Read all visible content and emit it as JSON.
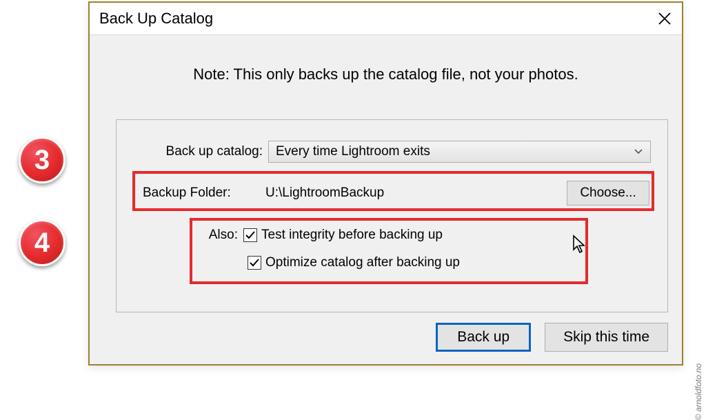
{
  "titlebar": {
    "title": "Back Up Catalog"
  },
  "note": "Note: This only backs up the catalog file, not your photos.",
  "labels": {
    "backup_catalog": "Back up catalog:",
    "backup_folder": "Backup Folder:",
    "also": "Also:"
  },
  "dropdown": {
    "selected": "Every time Lightroom exits"
  },
  "folder": {
    "path": "U:\\LightroomBackup",
    "choose_label": "Choose..."
  },
  "checkboxes": {
    "test_integrity": {
      "label": "Test integrity before backing up",
      "checked": true
    },
    "optimize": {
      "label": "Optimize catalog after backing up",
      "checked": true
    }
  },
  "buttons": {
    "backup": "Back up",
    "skip": "Skip this time"
  },
  "badges": {
    "three": "3",
    "four": "4"
  },
  "watermark": "© arnoldfoto.no"
}
